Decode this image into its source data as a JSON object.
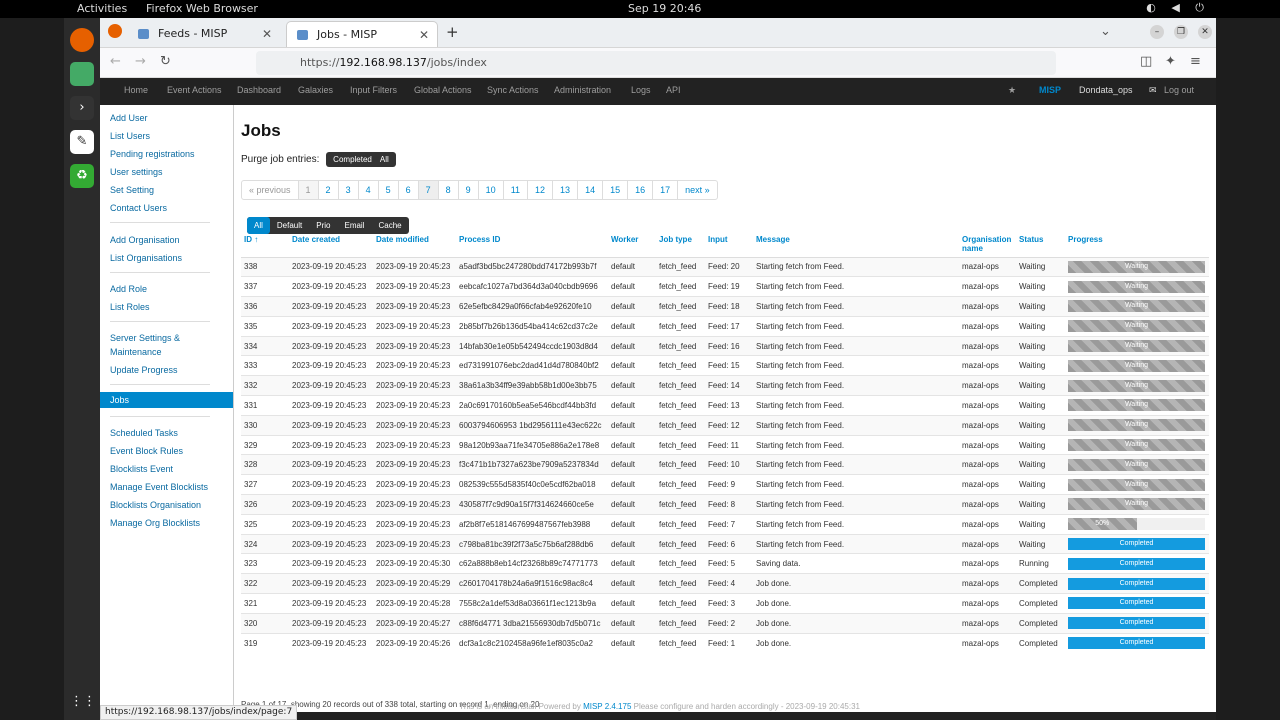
{
  "system": {
    "activities": "Activities",
    "app": "Firefox Web Browser",
    "clock": "Sep 19  20:46",
    "tray": "◐ ◀ ⏻"
  },
  "browser": {
    "tabs": [
      {
        "title": "Feeds - MISP"
      },
      {
        "title": "Jobs - MISP"
      }
    ],
    "url_prefix": "https://",
    "url_domain": "192.168.98.137",
    "url_path": "/jobs/index",
    "status_url": "https://192.168.98.137/jobs/index/page:7"
  },
  "nav": {
    "items": [
      "Home",
      "Event Actions",
      "Dashboard",
      "Galaxies",
      "Input Filters",
      "Global Actions",
      "Sync Actions",
      "Administration",
      "Logs",
      "API"
    ],
    "brand": "MISP",
    "user": "Dondata_ops",
    "logout": "Log out"
  },
  "sidebar": {
    "items": [
      "Add User",
      "List Users",
      "Pending registrations",
      "User settings",
      "Set Setting",
      "Contact Users",
      "Add Organisation",
      "List Organisations",
      "Add Role",
      "List Roles",
      "Server Settings & Maintenance",
      "Update Progress",
      "Jobs",
      "Scheduled Tasks",
      "Event Block Rules",
      "Blocklists Event",
      "Manage Event Blocklists",
      "Blocklists Organisation",
      "Manage Org Blocklists"
    ]
  },
  "page": {
    "title": "Jobs",
    "purge_label": "Purge job entries:",
    "purge_completed": "Completed",
    "purge_all": "All"
  },
  "pager": {
    "prev": "« previous",
    "pages": [
      "1",
      "2",
      "3",
      "4",
      "5",
      "6",
      "7",
      "8",
      "9",
      "10",
      "11",
      "12",
      "13",
      "14",
      "15",
      "16",
      "17"
    ],
    "current": "7",
    "next": "next »"
  },
  "filters": [
    "All",
    "Default",
    "Prio",
    "Email",
    "Cache"
  ],
  "table": {
    "headers": [
      "ID ↑",
      "Date created",
      "Date modified",
      "Process ID",
      "Worker",
      "Job type",
      "Input",
      "Message",
      "Organisation name",
      "Status",
      "Progress"
    ],
    "rows": [
      [
        "338",
        "2023-09-19 20:45:23",
        "2023-09-19 20:45:23",
        "a5adf3bd5bc247280bdd74172b993b7f",
        "default",
        "fetch_feed",
        "Feed: 20",
        "Starting fetch from Feed.",
        "mazal-ops",
        "Waiting",
        "Waiting"
      ],
      [
        "337",
        "2023-09-19 20:45:23",
        "2023-09-19 20:45:23",
        "eebcafc1027a7bd364d3a040cbdb9696",
        "default",
        "fetch_feed",
        "Feed: 19",
        "Starting fetch from Feed.",
        "mazal-ops",
        "Waiting",
        "Waiting"
      ],
      [
        "336",
        "2023-09-19 20:45:23",
        "2023-09-19 20:45:23",
        "62e5efbc8429a0f66cfab4e92620fe10",
        "default",
        "fetch_feed",
        "Feed: 18",
        "Starting fetch from Feed.",
        "mazal-ops",
        "Waiting",
        "Waiting"
      ],
      [
        "335",
        "2023-09-19 20:45:23",
        "2023-09-19 20:45:23",
        "2b85bf7b26b136d54ba414c62cd37c2e",
        "default",
        "fetch_feed",
        "Feed: 17",
        "Starting fetch from Feed.",
        "mazal-ops",
        "Waiting",
        "Waiting"
      ],
      [
        "334",
        "2023-09-19 20:45:23",
        "2023-09-19 20:45:23",
        "14bfab30e1e05b542494ccdc1903d8d4",
        "default",
        "fetch_feed",
        "Feed: 16",
        "Starting fetch from Feed.",
        "mazal-ops",
        "Waiting",
        "Waiting"
      ],
      [
        "333",
        "2023-09-19 20:45:23",
        "2023-09-19 20:45:23",
        "ed731991076ebc2dad41d4d780840bf2",
        "default",
        "fetch_feed",
        "Feed: 15",
        "Starting fetch from Feed.",
        "mazal-ops",
        "Waiting",
        "Waiting"
      ],
      [
        "332",
        "2023-09-19 20:45:23",
        "2023-09-19 20:45:23",
        "38a61a3b34ff9e39abb58b1d00e3bb75",
        "default",
        "fetch_feed",
        "Feed: 14",
        "Starting fetch from Feed.",
        "mazal-ops",
        "Waiting",
        "Waiting"
      ],
      [
        "331",
        "2023-09-19 20:45:23",
        "2023-09-19 20:45:23",
        "2a0c69170160b5ea5e546bcdf44bb3fd",
        "default",
        "fetch_feed",
        "Feed: 13",
        "Starting fetch from Feed.",
        "mazal-ops",
        "Waiting",
        "Waiting"
      ],
      [
        "330",
        "2023-09-19 20:45:23",
        "2023-09-19 20:45:23",
        "6003794606953 1bd2956111e43ec622c",
        "default",
        "fetch_feed",
        "Feed: 12",
        "Starting fetch from Feed.",
        "mazal-ops",
        "Waiting",
        "Waiting"
      ],
      [
        "329",
        "2023-09-19 20:45:23",
        "2023-09-19 20:45:23",
        "98a120b93aa71fe34705e886a2e178e8",
        "default",
        "fetch_feed",
        "Feed: 11",
        "Starting fetch from Feed.",
        "mazal-ops",
        "Waiting",
        "Waiting"
      ],
      [
        "328",
        "2023-09-19 20:45:23",
        "2023-09-19 20:45:23",
        "f3c471b1b7327a623be7909a5237834d",
        "default",
        "fetch_feed",
        "Feed: 10",
        "Starting fetch from Feed.",
        "mazal-ops",
        "Waiting",
        "Waiting"
      ],
      [
        "327",
        "2023-09-19 20:45:23",
        "2023-09-19 20:45:23",
        "082539c555d5835f40c0e5cdf62ba018",
        "default",
        "fetch_feed",
        "Feed: 9",
        "Starting fetch from Feed.",
        "mazal-ops",
        "Waiting",
        "Waiting"
      ],
      [
        "326",
        "2023-09-19 20:45:23",
        "2023-09-19 20:45:23",
        "430587f7c9d90a15f7f314624660ce5e",
        "default",
        "fetch_feed",
        "Feed: 8",
        "Starting fetch from Feed.",
        "mazal-ops",
        "Waiting",
        "Waiting"
      ],
      [
        "325",
        "2023-09-19 20:45:23",
        "2023-09-19 20:45:23",
        "af2b8f7e5181467699487567feb3988",
        "default",
        "fetch_feed",
        "Feed: 7",
        "Starting fetch from Feed.",
        "mazal-ops",
        "Waiting",
        "50%"
      ],
      [
        "324",
        "2023-09-19 20:45:23",
        "2023-09-19 20:45:23",
        "c798ba81bc39f2f73a5c75b6af288db6",
        "default",
        "fetch_feed",
        "Feed: 6",
        "Starting fetch from Feed.",
        "mazal-ops",
        "Waiting",
        "Completed"
      ],
      [
        "323",
        "2023-09-19 20:45:23",
        "2023-09-19 20:45:30",
        "c62a888b8eb14cf23268b89c74771773",
        "default",
        "fetch_feed",
        "Feed: 5",
        "Saving data.",
        "mazal-ops",
        "Running",
        "Completed"
      ],
      [
        "322",
        "2023-09-19 20:45:23",
        "2023-09-19 20:45:29",
        "c2601704178b24a6a9f1516c98ac8c4",
        "default",
        "fetch_feed",
        "Feed: 4",
        "Job done.",
        "mazal-ops",
        "Completed",
        "Completed"
      ],
      [
        "321",
        "2023-09-19 20:45:23",
        "2023-09-19 20:45:28",
        "7558c2a1def53d8a03661f1ec1213b9a",
        "default",
        "fetch_feed",
        "Feed: 3",
        "Job done.",
        "mazal-ops",
        "Completed",
        "Completed"
      ],
      [
        "320",
        "2023-09-19 20:45:23",
        "2023-09-19 20:45:27",
        "c88f6d4771 3dba21556930db7d5b071c",
        "default",
        "fetch_feed",
        "Feed: 2",
        "Job done.",
        "mazal-ops",
        "Completed",
        "Completed"
      ],
      [
        "319",
        "2023-09-19 20:45:23",
        "2023-09-19 20:45:26",
        "dcf3a1c8c2102458a96fe1ef8035c0a2",
        "default",
        "fetch_feed",
        "Feed: 1",
        "Job done.",
        "mazal-ops",
        "Completed",
        "Completed"
      ]
    ],
    "progress": [
      0,
      0,
      0,
      0,
      0,
      0,
      0,
      0,
      0,
      0,
      0,
      0,
      0,
      0.5,
      1,
      1,
      1,
      1,
      1,
      1
    ]
  },
  "summary": "Page 1 of 17, showing 20 records out of 338 total, starting on record 1, ending on 20",
  "footer": {
    "pre": "This is an initial install Powered by ",
    "link": "MISP 2.4.175",
    "post": " Please configure and harden accordingly - 2023-09-19 20:45:31"
  },
  "colors": {
    "accent": "#0088cc",
    "navbar": "#222222",
    "completed": "#149bdf"
  }
}
